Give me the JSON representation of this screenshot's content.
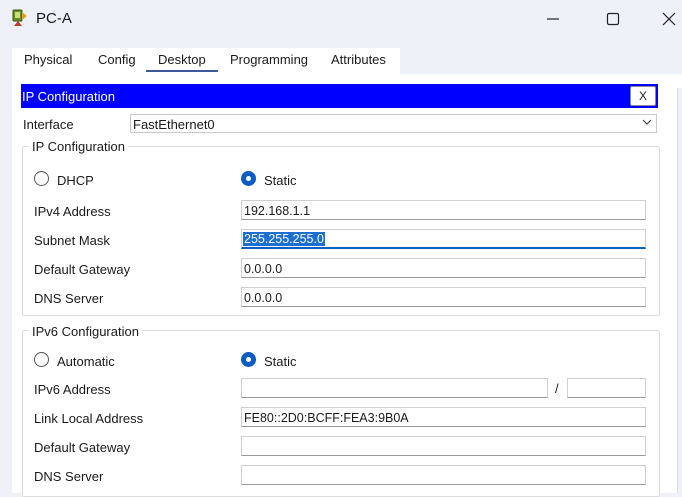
{
  "window": {
    "title": "PC-A",
    "icon": "pc-app-icon"
  },
  "tabs": [
    {
      "label": "Physical"
    },
    {
      "label": "Config"
    },
    {
      "label": "Desktop",
      "active": true
    },
    {
      "label": "Programming"
    },
    {
      "label": "Attributes"
    }
  ],
  "ip_config": {
    "header_title": "IP Configuration",
    "close_label": "X",
    "interface_label": "Interface",
    "interface_value": "FastEthernet0",
    "ipv4": {
      "group_title": "IP Configuration",
      "dhcp_label": "DHCP",
      "static_label": "Static",
      "selected_mode": "Static",
      "ipv4_label": "IPv4 Address",
      "ipv4_value": "192.168.1.1",
      "mask_label": "Subnet Mask",
      "mask_value": "255.255.255.0",
      "gateway_label": "Default Gateway",
      "gateway_value": "0.0.0.0",
      "dns_label": "DNS Server",
      "dns_value": "0.0.0.0"
    },
    "ipv6": {
      "group_title": "IPv6 Configuration",
      "auto_label": "Automatic",
      "static_label": "Static",
      "selected_mode": "Static",
      "address_label": "IPv6 Address",
      "address_value": "",
      "prefix_separator": "/",
      "prefix_value": "",
      "link_local_label": "Link Local Address",
      "link_local_value": "FE80::2D0:BCFF:FEA3:9B0A",
      "gateway_label": "Default Gateway",
      "gateway_value": "",
      "dns_label": "DNS Server",
      "dns_value": ""
    }
  },
  "colors": {
    "header_blue": "#0000ff",
    "radio_selected": "#0a5dc2",
    "selection_highlight": "#1b6fd1"
  }
}
